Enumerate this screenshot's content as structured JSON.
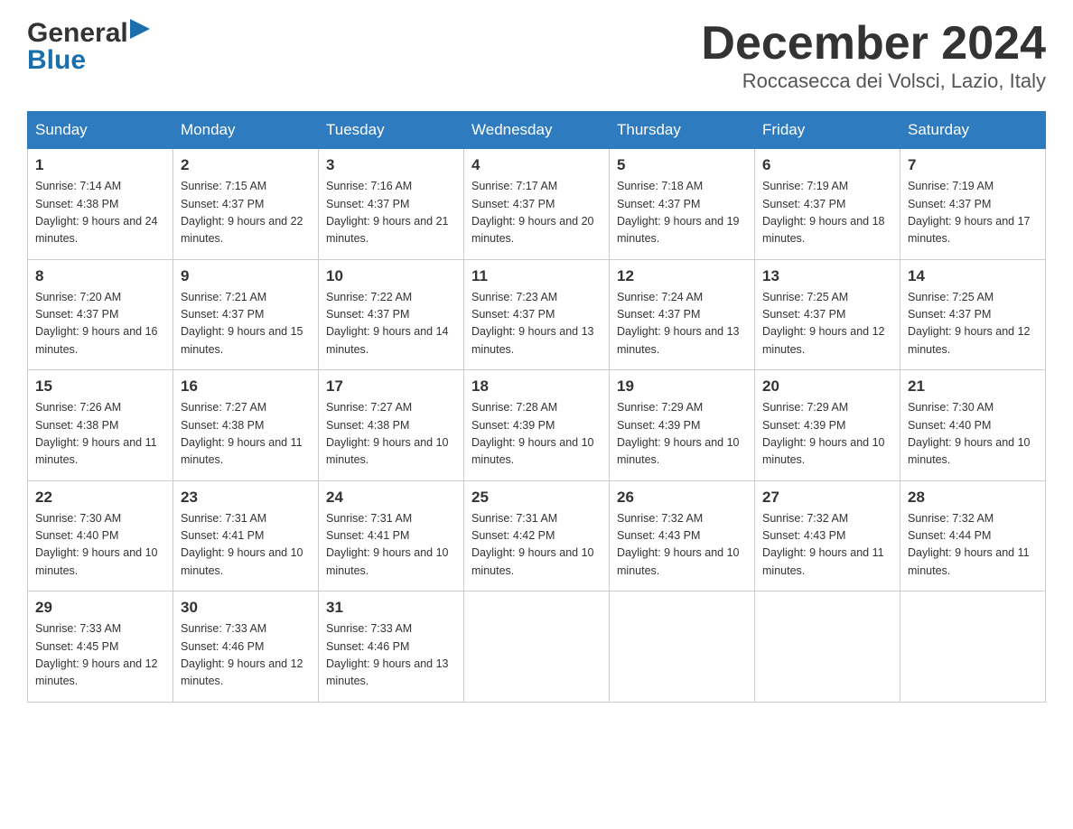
{
  "header": {
    "logo_general": "General",
    "logo_blue": "Blue",
    "title": "December 2024",
    "subtitle": "Roccasecca dei Volsci, Lazio, Italy"
  },
  "calendar": {
    "days_of_week": [
      "Sunday",
      "Monday",
      "Tuesday",
      "Wednesday",
      "Thursday",
      "Friday",
      "Saturday"
    ],
    "weeks": [
      [
        {
          "day": "1",
          "sunrise": "7:14 AM",
          "sunset": "4:38 PM",
          "daylight": "9 hours and 24 minutes."
        },
        {
          "day": "2",
          "sunrise": "7:15 AM",
          "sunset": "4:37 PM",
          "daylight": "9 hours and 22 minutes."
        },
        {
          "day": "3",
          "sunrise": "7:16 AM",
          "sunset": "4:37 PM",
          "daylight": "9 hours and 21 minutes."
        },
        {
          "day": "4",
          "sunrise": "7:17 AM",
          "sunset": "4:37 PM",
          "daylight": "9 hours and 20 minutes."
        },
        {
          "day": "5",
          "sunrise": "7:18 AM",
          "sunset": "4:37 PM",
          "daylight": "9 hours and 19 minutes."
        },
        {
          "day": "6",
          "sunrise": "7:19 AM",
          "sunset": "4:37 PM",
          "daylight": "9 hours and 18 minutes."
        },
        {
          "day": "7",
          "sunrise": "7:19 AM",
          "sunset": "4:37 PM",
          "daylight": "9 hours and 17 minutes."
        }
      ],
      [
        {
          "day": "8",
          "sunrise": "7:20 AM",
          "sunset": "4:37 PM",
          "daylight": "9 hours and 16 minutes."
        },
        {
          "day": "9",
          "sunrise": "7:21 AM",
          "sunset": "4:37 PM",
          "daylight": "9 hours and 15 minutes."
        },
        {
          "day": "10",
          "sunrise": "7:22 AM",
          "sunset": "4:37 PM",
          "daylight": "9 hours and 14 minutes."
        },
        {
          "day": "11",
          "sunrise": "7:23 AM",
          "sunset": "4:37 PM",
          "daylight": "9 hours and 13 minutes."
        },
        {
          "day": "12",
          "sunrise": "7:24 AM",
          "sunset": "4:37 PM",
          "daylight": "9 hours and 13 minutes."
        },
        {
          "day": "13",
          "sunrise": "7:25 AM",
          "sunset": "4:37 PM",
          "daylight": "9 hours and 12 minutes."
        },
        {
          "day": "14",
          "sunrise": "7:25 AM",
          "sunset": "4:37 PM",
          "daylight": "9 hours and 12 minutes."
        }
      ],
      [
        {
          "day": "15",
          "sunrise": "7:26 AM",
          "sunset": "4:38 PM",
          "daylight": "9 hours and 11 minutes."
        },
        {
          "day": "16",
          "sunrise": "7:27 AM",
          "sunset": "4:38 PM",
          "daylight": "9 hours and 11 minutes."
        },
        {
          "day": "17",
          "sunrise": "7:27 AM",
          "sunset": "4:38 PM",
          "daylight": "9 hours and 10 minutes."
        },
        {
          "day": "18",
          "sunrise": "7:28 AM",
          "sunset": "4:39 PM",
          "daylight": "9 hours and 10 minutes."
        },
        {
          "day": "19",
          "sunrise": "7:29 AM",
          "sunset": "4:39 PM",
          "daylight": "9 hours and 10 minutes."
        },
        {
          "day": "20",
          "sunrise": "7:29 AM",
          "sunset": "4:39 PM",
          "daylight": "9 hours and 10 minutes."
        },
        {
          "day": "21",
          "sunrise": "7:30 AM",
          "sunset": "4:40 PM",
          "daylight": "9 hours and 10 minutes."
        }
      ],
      [
        {
          "day": "22",
          "sunrise": "7:30 AM",
          "sunset": "4:40 PM",
          "daylight": "9 hours and 10 minutes."
        },
        {
          "day": "23",
          "sunrise": "7:31 AM",
          "sunset": "4:41 PM",
          "daylight": "9 hours and 10 minutes."
        },
        {
          "day": "24",
          "sunrise": "7:31 AM",
          "sunset": "4:41 PM",
          "daylight": "9 hours and 10 minutes."
        },
        {
          "day": "25",
          "sunrise": "7:31 AM",
          "sunset": "4:42 PM",
          "daylight": "9 hours and 10 minutes."
        },
        {
          "day": "26",
          "sunrise": "7:32 AM",
          "sunset": "4:43 PM",
          "daylight": "9 hours and 10 minutes."
        },
        {
          "day": "27",
          "sunrise": "7:32 AM",
          "sunset": "4:43 PM",
          "daylight": "9 hours and 11 minutes."
        },
        {
          "day": "28",
          "sunrise": "7:32 AM",
          "sunset": "4:44 PM",
          "daylight": "9 hours and 11 minutes."
        }
      ],
      [
        {
          "day": "29",
          "sunrise": "7:33 AM",
          "sunset": "4:45 PM",
          "daylight": "9 hours and 12 minutes."
        },
        {
          "day": "30",
          "sunrise": "7:33 AM",
          "sunset": "4:46 PM",
          "daylight": "9 hours and 12 minutes."
        },
        {
          "day": "31",
          "sunrise": "7:33 AM",
          "sunset": "4:46 PM",
          "daylight": "9 hours and 13 minutes."
        },
        null,
        null,
        null,
        null
      ]
    ]
  }
}
